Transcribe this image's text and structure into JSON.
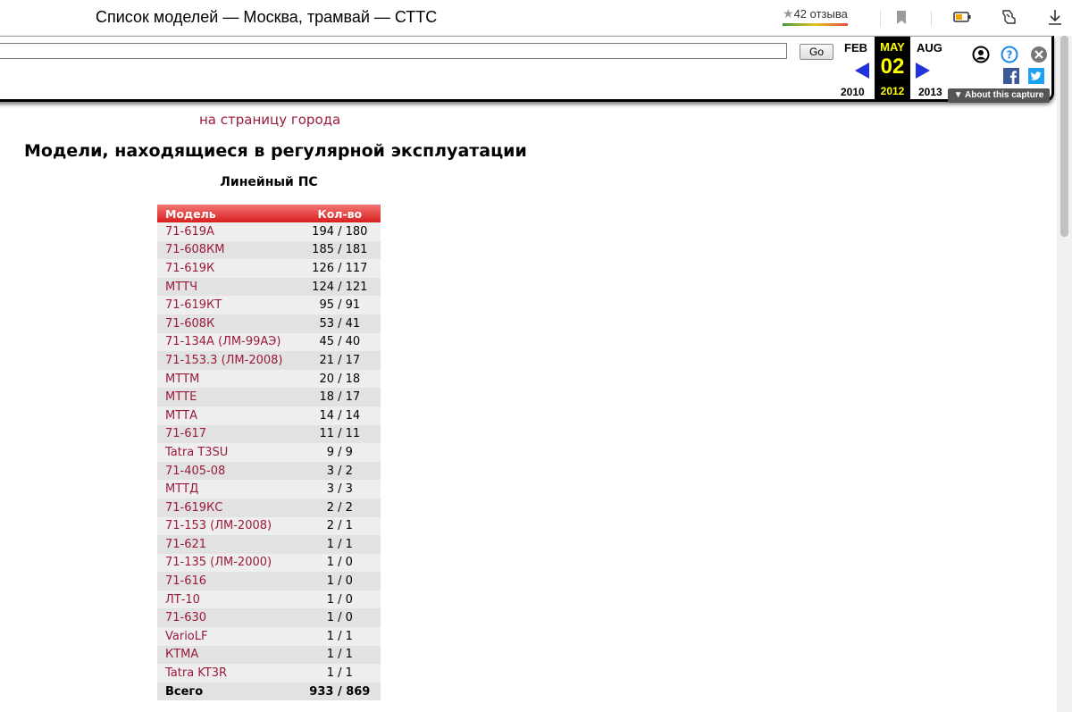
{
  "browser": {
    "tab_title": "Список моделей — Москва, трамвай — СТТС",
    "reviews": "42 отзыва"
  },
  "wayback": {
    "url_value": "",
    "go_label": "Go",
    "prev_month": "FEB",
    "cur_month": "MAY",
    "next_month": "AUG",
    "prev_year": "2010",
    "cur_year": "2012",
    "next_year": "2013",
    "cur_day": "02",
    "about_label": "About this capture"
  },
  "page": {
    "city_link": "на страницу города",
    "heading": "Модели, находящиеся в регулярной эксплуатации",
    "subheading": "Линейный ПС"
  },
  "table": {
    "headers": [
      "Модель",
      "Кол-во"
    ],
    "rows": [
      {
        "model": "71-619А",
        "count": "194 / 180"
      },
      {
        "model": "71-608КМ",
        "count": "185 / 181"
      },
      {
        "model": "71-619К",
        "count": "126 / 117"
      },
      {
        "model": "МТТЧ",
        "count": "124 / 121"
      },
      {
        "model": "71-619КТ",
        "count": "95 / 91"
      },
      {
        "model": "71-608К",
        "count": "53 / 41"
      },
      {
        "model": "71-134А (ЛМ-99АЭ)",
        "count": "45 / 40"
      },
      {
        "model": "71-153.3 (ЛМ-2008)",
        "count": "21 / 17"
      },
      {
        "model": "МТТМ",
        "count": "20 / 18"
      },
      {
        "model": "МТТЕ",
        "count": "18 / 17"
      },
      {
        "model": "МТТА",
        "count": "14 / 14"
      },
      {
        "model": "71-617",
        "count": "11 / 11"
      },
      {
        "model": "Tatra T3SU",
        "count": "9 / 9"
      },
      {
        "model": "71-405-08",
        "count": "3 / 2"
      },
      {
        "model": "МТТД",
        "count": "3 / 3"
      },
      {
        "model": "71-619КС",
        "count": "2 / 2"
      },
      {
        "model": "71-153 (ЛМ-2008)",
        "count": "2 / 1"
      },
      {
        "model": "71-621",
        "count": "1 / 1"
      },
      {
        "model": "71-135 (ЛМ-2000)",
        "count": "1 / 0"
      },
      {
        "model": "71-616",
        "count": "1 / 0"
      },
      {
        "model": "ЛТ-10",
        "count": "1 / 0"
      },
      {
        "model": "71-630",
        "count": "1 / 0"
      },
      {
        "model": "VarioLF",
        "count": "1 / 1"
      },
      {
        "model": "КТМА",
        "count": "1 / 1"
      },
      {
        "model": "Tatra KT3R",
        "count": "1 / 1"
      }
    ],
    "total_label": "Всего",
    "total_count": "933 / 869"
  },
  "colors": {
    "link": "#9a1b3a",
    "header_red": "#d71f1f",
    "wayback_yellow": "#ffff00"
  }
}
